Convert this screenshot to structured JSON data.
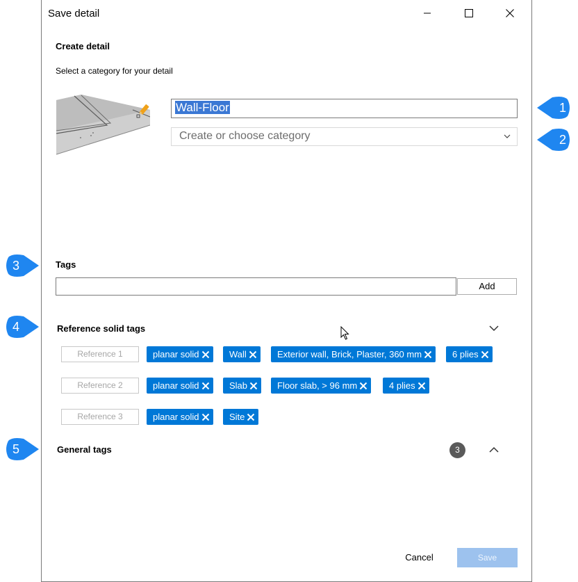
{
  "window": {
    "title": "Save detail",
    "minimize_icon": "minimize-icon",
    "maximize_icon": "maximize-icon",
    "close_icon": "close-icon"
  },
  "create": {
    "heading": "Create detail",
    "subtitle": "Select a category for your detail",
    "name_value": "Wall-Floor",
    "category_placeholder": "Create or choose category"
  },
  "tags": {
    "heading": "Tags",
    "input_value": "",
    "add_label": "Add"
  },
  "reference_tags": {
    "heading": "Reference solid tags",
    "rows": [
      {
        "reference": "Reference 1",
        "chips": [
          "planar solid",
          "Wall",
          "Exterior wall, Brick, Plaster, 360 mm",
          "6 plies"
        ]
      },
      {
        "reference": "Reference 2",
        "chips": [
          "planar solid",
          "Slab",
          "Floor slab, > 96 mm",
          "4 plies"
        ]
      },
      {
        "reference": "Reference 3",
        "chips": [
          "planar solid",
          "Site"
        ]
      }
    ]
  },
  "general_tags": {
    "heading": "General tags",
    "count": "3"
  },
  "footer": {
    "cancel_label": "Cancel",
    "save_label": "Save"
  },
  "callouts": [
    "1",
    "2",
    "3",
    "4",
    "5"
  ],
  "colors": {
    "accent": "#0078d7",
    "callout": "#1f86f0",
    "selection": "#3b78d4",
    "save_disabled": "#9dc2ee",
    "badge": "#5a5a5a"
  }
}
